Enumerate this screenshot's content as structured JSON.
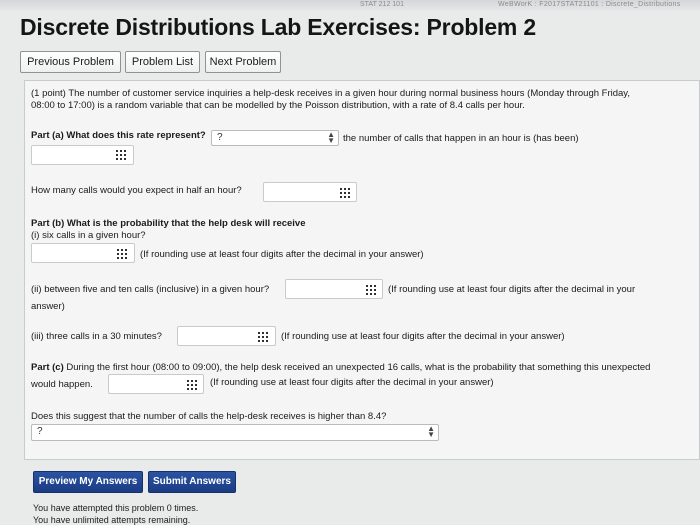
{
  "browser_strip": {
    "left_text": "STAT 212 101",
    "right_text": "WeBWorK : F2017STAT21101 : Discrete_Distributions"
  },
  "page_title": "Discrete Distributions Lab Exercises: Problem 2",
  "nav": {
    "previous": "Previous Problem",
    "list": "Problem List",
    "next": "Next Problem"
  },
  "problem": {
    "intro_line1": "(1 point) The number of customer service inquiries a help-desk receives in a given hour during normal business hours (Monday through Friday,",
    "intro_line2": "08:00 to 17:00) is a random variable that can be modelled by the Poisson distribution, with a rate of 8.4 calls per hour.",
    "part_a": {
      "label": "Part (a) What does this rate represent?",
      "select_value": "?",
      "select_text": "the number of calls that happen in an hour is (has been)",
      "half_hour_question": "How many calls would you expect in half an hour?"
    },
    "part_b": {
      "label": "Part (b) What is the probability that the help desk will receive",
      "i_text": "(i) six calls in a given hour?",
      "rounding_note": "(If rounding use at least four digits after the decimal in your answer)",
      "ii_text": "(ii) between five and ten calls (inclusive) in a given hour?",
      "ii_note": "(If rounding use at least four digits after the decimal in your",
      "ii_note_cont": "answer)",
      "iii_text": "(iii) three calls in a 30 minutes?",
      "iii_note": "(If rounding use at least four digits after the decimal in your answer)"
    },
    "part_c": {
      "line1": "Part (c) During the first hour (08:00 to 09:00), the help desk received an unexpected 16 calls, what is the probability that something this unexpected",
      "line2": "would happen.",
      "note": "(If rounding use at least four digits after the decimal in your answer)",
      "question": "Does this suggest that the number of calls the help-desk receives is higher than 8.4?",
      "select_value": "?"
    }
  },
  "buttons": {
    "preview": "Preview My Answers",
    "submit": "Submit Answers"
  },
  "footer": {
    "attempted": "You have attempted this problem 0 times.",
    "remaining": "You have unlimited attempts remaining."
  },
  "colors": {
    "submit_bg": "#1f448e",
    "page_bg": "#e9ebea"
  }
}
